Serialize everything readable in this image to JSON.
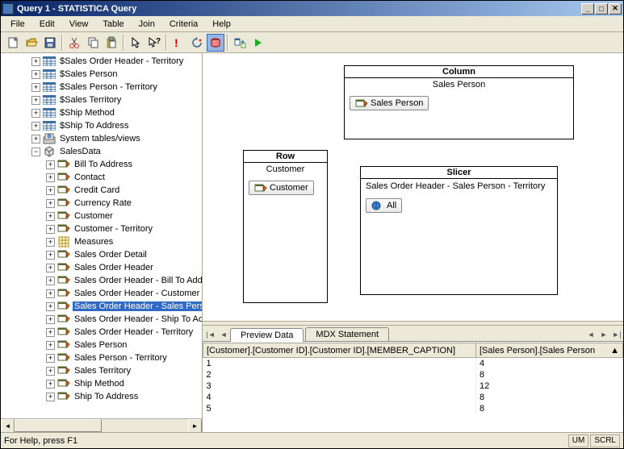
{
  "title": "Query 1 - STATISTICA Query",
  "menu": [
    "File",
    "Edit",
    "View",
    "Table",
    "Join",
    "Criteria",
    "Help"
  ],
  "tree": {
    "top": [
      "$Sales Order Header - Territory",
      "$Sales Person",
      "$Sales Person - Territory",
      "$Sales Territory",
      "$Ship Method",
      "$Ship To Address",
      "System tables/views"
    ],
    "cube": "SalesData",
    "children": [
      "Bill To Address",
      "Contact",
      "Credit Card",
      "Currency Rate",
      "Customer",
      "Customer - Territory",
      "Measures",
      "Sales Order Detail",
      "Sales Order Header",
      "Sales Order Header - Bill To Address",
      "Sales Order Header - Customer",
      "Sales Order Header - Sales Person",
      "Sales Order Header - Ship To Address",
      "Sales Order Header - Territory",
      "Sales Person",
      "Sales Person - Territory",
      "Sales Territory",
      "Ship Method",
      "Ship To Address"
    ],
    "selected_index": 11
  },
  "design": {
    "column": {
      "title": "Column",
      "field": "Sales Person",
      "chip": "Sales Person"
    },
    "row": {
      "title": "Row",
      "field": "Customer",
      "chip": "Customer"
    },
    "slicer": {
      "title": "Slicer",
      "field": "Sales Order Header - Sales Person - Territory",
      "chip": "All"
    }
  },
  "tabs": {
    "preview": "Preview Data",
    "mdx": "MDX Statement"
  },
  "grid": {
    "cols": [
      "[Customer].[Customer ID].[Customer ID].[MEMBER_CAPTION]",
      "[Sales Person].[Sales Person"
    ],
    "rows": [
      [
        "1",
        "4"
      ],
      [
        "2",
        "8"
      ],
      [
        "3",
        "12"
      ],
      [
        "4",
        "8"
      ],
      [
        "5",
        "8"
      ]
    ]
  },
  "status": {
    "text": "For Help, press F1",
    "c1": "UM",
    "c2": "SCRL"
  },
  "icons": {
    "table_svg": "<svg width='16' height='12' viewBox='0 0 16 12'><rect x='0' y='0' width='16' height='12' fill='#fff' stroke='#3a6ea5'/><rect x='0' y='0' width='16' height='3' fill='#3a6ea5'/><line x1='5' y1='0' x2='5' y2='12' stroke='#3a6ea5'/><line x1='10' y1='0' x2='10' y2='12' stroke='#3a6ea5'/><line x1='0' y1='6' x2='16' y2='6' stroke='#3a6ea5'/><line x1='0' y1='9' x2='16' y2='9' stroke='#3a6ea5'/></svg>",
    "dim_svg": "<svg width='16' height='14' viewBox='0 0 16 14'><rect x='1' y='2' width='10' height='8' fill='#fff' stroke='#556b2f'/><rect x='1' y='2' width='10' height='2' fill='#556b2f'/><path d='M11 3 L15 6 L12 10 Z' fill='#d2691e' stroke='#8b4513'/></svg>",
    "meas_svg": "<svg width='16' height='14' viewBox='0 0 16 14'><rect x='2' y='1' width='12' height='12' fill='#ffd' stroke='#b8860b'/><line x1='2' y1='5' x2='14' y2='5' stroke='#b8860b'/><line x1='2' y1='9' x2='14' y2='9' stroke='#b8860b'/><line x1='6' y1='1' x2='6' y2='13' stroke='#b8860b'/><line x1='10' y1='1' x2='10' y2='13' stroke='#b8860b'/></svg>",
    "sys_svg": "<svg width='16' height='14' viewBox='0 0 16 14'><rect x='1' y='5' width='14' height='8' fill='#ccc' stroke='#666'/><rect x='3' y='1' width='10' height='7' fill='#eee' stroke='#666'/><circle cx='8' cy='4' r='2' fill='#6af' stroke='#369'/></svg>",
    "cube_svg": "<svg width='16' height='14' viewBox='0 0 16 14'><path d='M3 4 L8 1 L13 4 L13 10 L8 13 L3 10 Z' fill='#ddd' stroke='#555'/><path d='M3 4 L8 7 L13 4 M8 7 L8 13' stroke='#555' fill='none'/></svg>",
    "globe_svg": "<svg width='12' height='12' viewBox='0 0 12 12'><circle cx='6' cy='6' r='5' fill='#4a90d9' stroke='#1a5490'/><ellipse cx='6' cy='6' rx='5' ry='2' fill='none' stroke='#1a5490'/><line x1='6' y1='1' x2='6' y2='11' stroke='#1a5490'/></svg>"
  }
}
